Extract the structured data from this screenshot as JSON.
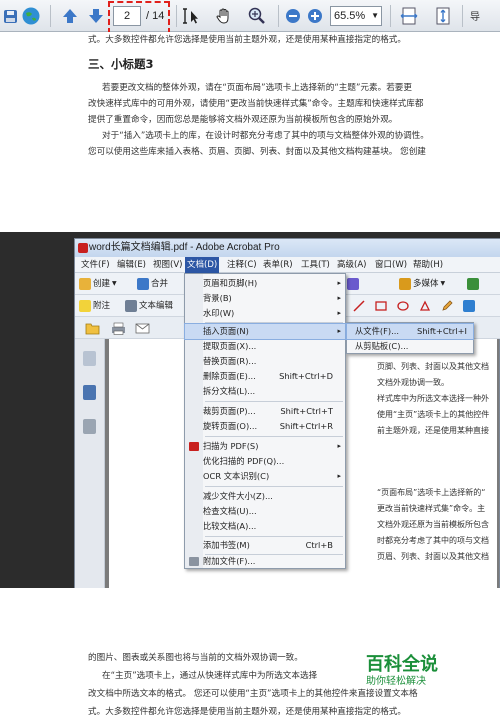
{
  "toolbar": {
    "page_current": "2",
    "page_total": "/ 14",
    "zoom": "65.5%",
    "nav_tag": "导"
  },
  "page1": {
    "line_top": "式。大多数控件都允许您选择是使用当前主题外观，还是使用某种直接指定的格式。",
    "heading": "三、小标题3",
    "lines": [
      "若要更改文档的整体外观，请在“页面布局”选项卡上选择新的“主题”元素。若要更",
      "改快速样式库中的可用外观，请使用“更改当前快速样式集”命令。主题库和快速样式库都",
      "提供了重置命令，因而您总是能够将文档外观还原为当前模板所包含的原始外观。",
      "对于“插入”选项卡上的库，在设计时都充分考虑了其中的项与文档整体外观的协调性。",
      "您可以使用这些库来插入表格、页眉、页脚、列表、封面以及其他文档构建基块。 您创建"
    ]
  },
  "window": {
    "title": "word长篇文档编辑.pdf - Adobe Acrobat Pro",
    "menus": [
      "文件(F)",
      "编辑(E)",
      "视图(V)",
      "文档(D)",
      "注释(C)",
      "表单(R)",
      "工具(T)",
      "高级(A)",
      "窗口(W)",
      "帮助(H)"
    ],
    "toolbar1": {
      "create": "创建",
      "merge": "合并",
      "multimedia": "多媒体"
    },
    "toolbar2": {
      "attach": "附注",
      "text_edit": "文本编辑"
    },
    "inner_lines": [
      "页脚、列表、封面以及其他文档",
      "文档外观协调一致。",
      "样式库中为所选文本选择一种外",
      "使用“主页”选项卡上的其他控件",
      "前主题外观，还是使用某种直接",
      "“页面布局”选项卡上选择新的“",
      "更改当前快速样式集”命令。主",
      "文档外观还原为当前模板所包含",
      "时都充分考虑了其中的项与文档",
      "页眉、列表、封面以及其他文档"
    ]
  },
  "dropdown": {
    "items": [
      {
        "label": "页眉和页脚(H)",
        "shortcut": "",
        "arrow": "▸"
      },
      {
        "label": "背景(B)",
        "shortcut": "",
        "arrow": "▸"
      },
      {
        "label": "水印(W)",
        "shortcut": "",
        "arrow": "▸"
      },
      {
        "label": "插入页面(N)",
        "shortcut": "",
        "arrow": "▸"
      },
      {
        "label": "提取页面(X)...",
        "shortcut": "",
        "arrow": ""
      },
      {
        "label": "替换页面(R)...",
        "shortcut": "",
        "arrow": ""
      },
      {
        "label": "删除页面(E)...",
        "shortcut": "Shift+Ctrl+D",
        "arrow": ""
      },
      {
        "label": "拆分文档(L)...",
        "shortcut": "",
        "arrow": ""
      },
      {
        "label": "裁剪页面(P)...",
        "shortcut": "Shift+Ctrl+T",
        "arrow": ""
      },
      {
        "label": "旋转页面(O)...",
        "shortcut": "Shift+Ctrl+R",
        "arrow": ""
      },
      {
        "label": "扫描为 PDF(S)",
        "shortcut": "",
        "arrow": "▸"
      },
      {
        "label": "优化扫描的 PDF(Q)...",
        "shortcut": "",
        "arrow": ""
      },
      {
        "label": "OCR 文本识别(C)",
        "shortcut": "",
        "arrow": "▸"
      },
      {
        "label": "减少文件大小(Z)...",
        "shortcut": "",
        "arrow": ""
      },
      {
        "label": "检查文档(U)...",
        "shortcut": "",
        "arrow": ""
      },
      {
        "label": "比较文档(A)...",
        "shortcut": "",
        "arrow": ""
      },
      {
        "label": "添加书签(M)",
        "shortcut": "Ctrl+B",
        "arrow": ""
      },
      {
        "label": "附加文件(F)...",
        "shortcut": "",
        "arrow": ""
      }
    ]
  },
  "submenu": {
    "items": [
      {
        "label": "从文件(F)...",
        "shortcut": "Shift+Ctrl+I"
      },
      {
        "label": "从剪贴板(C)...",
        "shortcut": ""
      }
    ]
  },
  "page2": {
    "lines": [
      "的图片、图表或关系图也将与当前的文档外观协调一致。",
      "在“主页”选项卡上，通过从快速样式库中为所选文本选择",
      "改文档中所选文本的格式。 您还可以使用“主页”选项卡上的其他控件来直接设置文本格",
      "式。大多数控件都允许您选择是使用当前主题外观，还是使用某种直接指定的格式。"
    ]
  },
  "watermark": {
    "brand": "百科全说",
    "slogan": "助你轻松解决"
  },
  "colors": {
    "highlight_dash": "#e0201b",
    "menu_active": "#2c56a5",
    "watermark": "#1b8f3a"
  }
}
